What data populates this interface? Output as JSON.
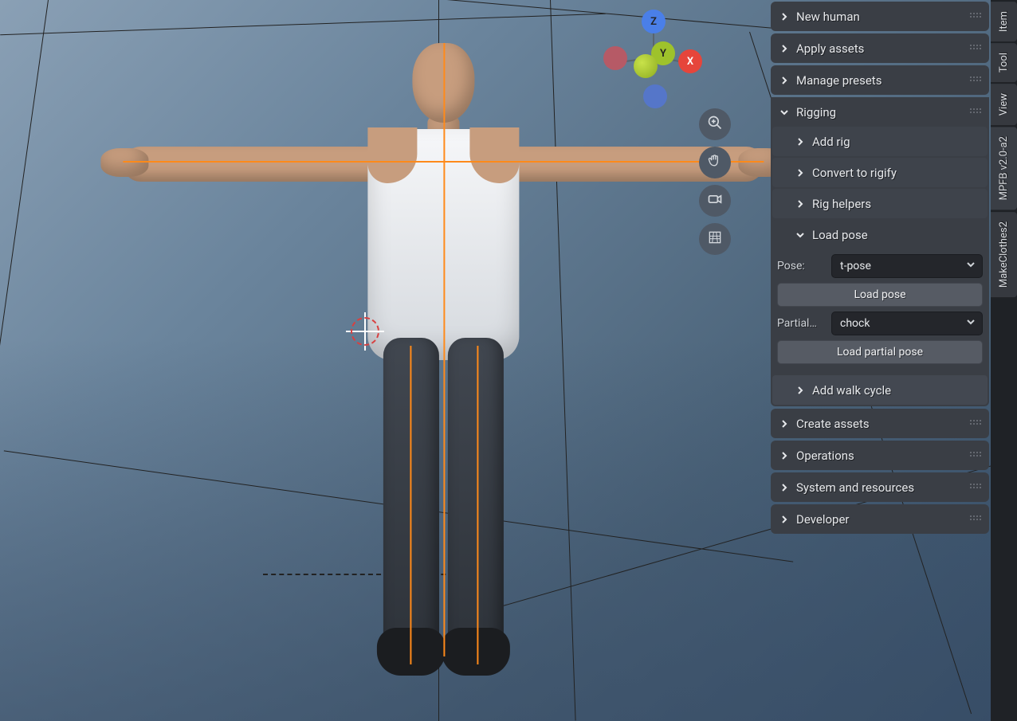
{
  "gizmo": {
    "x": "X",
    "y": "Y",
    "z": "Z"
  },
  "viewport_tools": {
    "zoom": "zoom-icon",
    "pan": "hand-icon",
    "camera": "camera-icon",
    "grid": "grid-icon"
  },
  "panel": {
    "sections": {
      "new_human": "New human",
      "apply_assets": "Apply assets",
      "manage_presets": "Manage presets",
      "rigging": "Rigging",
      "create_assets": "Create assets",
      "operations": "Operations",
      "system_resources": "System and resources",
      "developer": "Developer"
    },
    "rigging": {
      "add_rig": "Add rig",
      "convert_rigify": "Convert to rigify",
      "rig_helpers": "Rig helpers",
      "load_pose_header": "Load pose",
      "pose_label": "Pose:",
      "pose_value": "t-pose",
      "load_pose_btn": "Load pose",
      "partial_label": "Partial…",
      "partial_value": "chock",
      "load_partial_btn": "Load partial pose",
      "add_walk_cycle": "Add walk cycle"
    }
  },
  "vtabs": {
    "item": "Item",
    "tool": "Tool",
    "view": "View",
    "mpfb": "MPFB v2.0-a2",
    "makeclothes": "MakeClothes2"
  }
}
